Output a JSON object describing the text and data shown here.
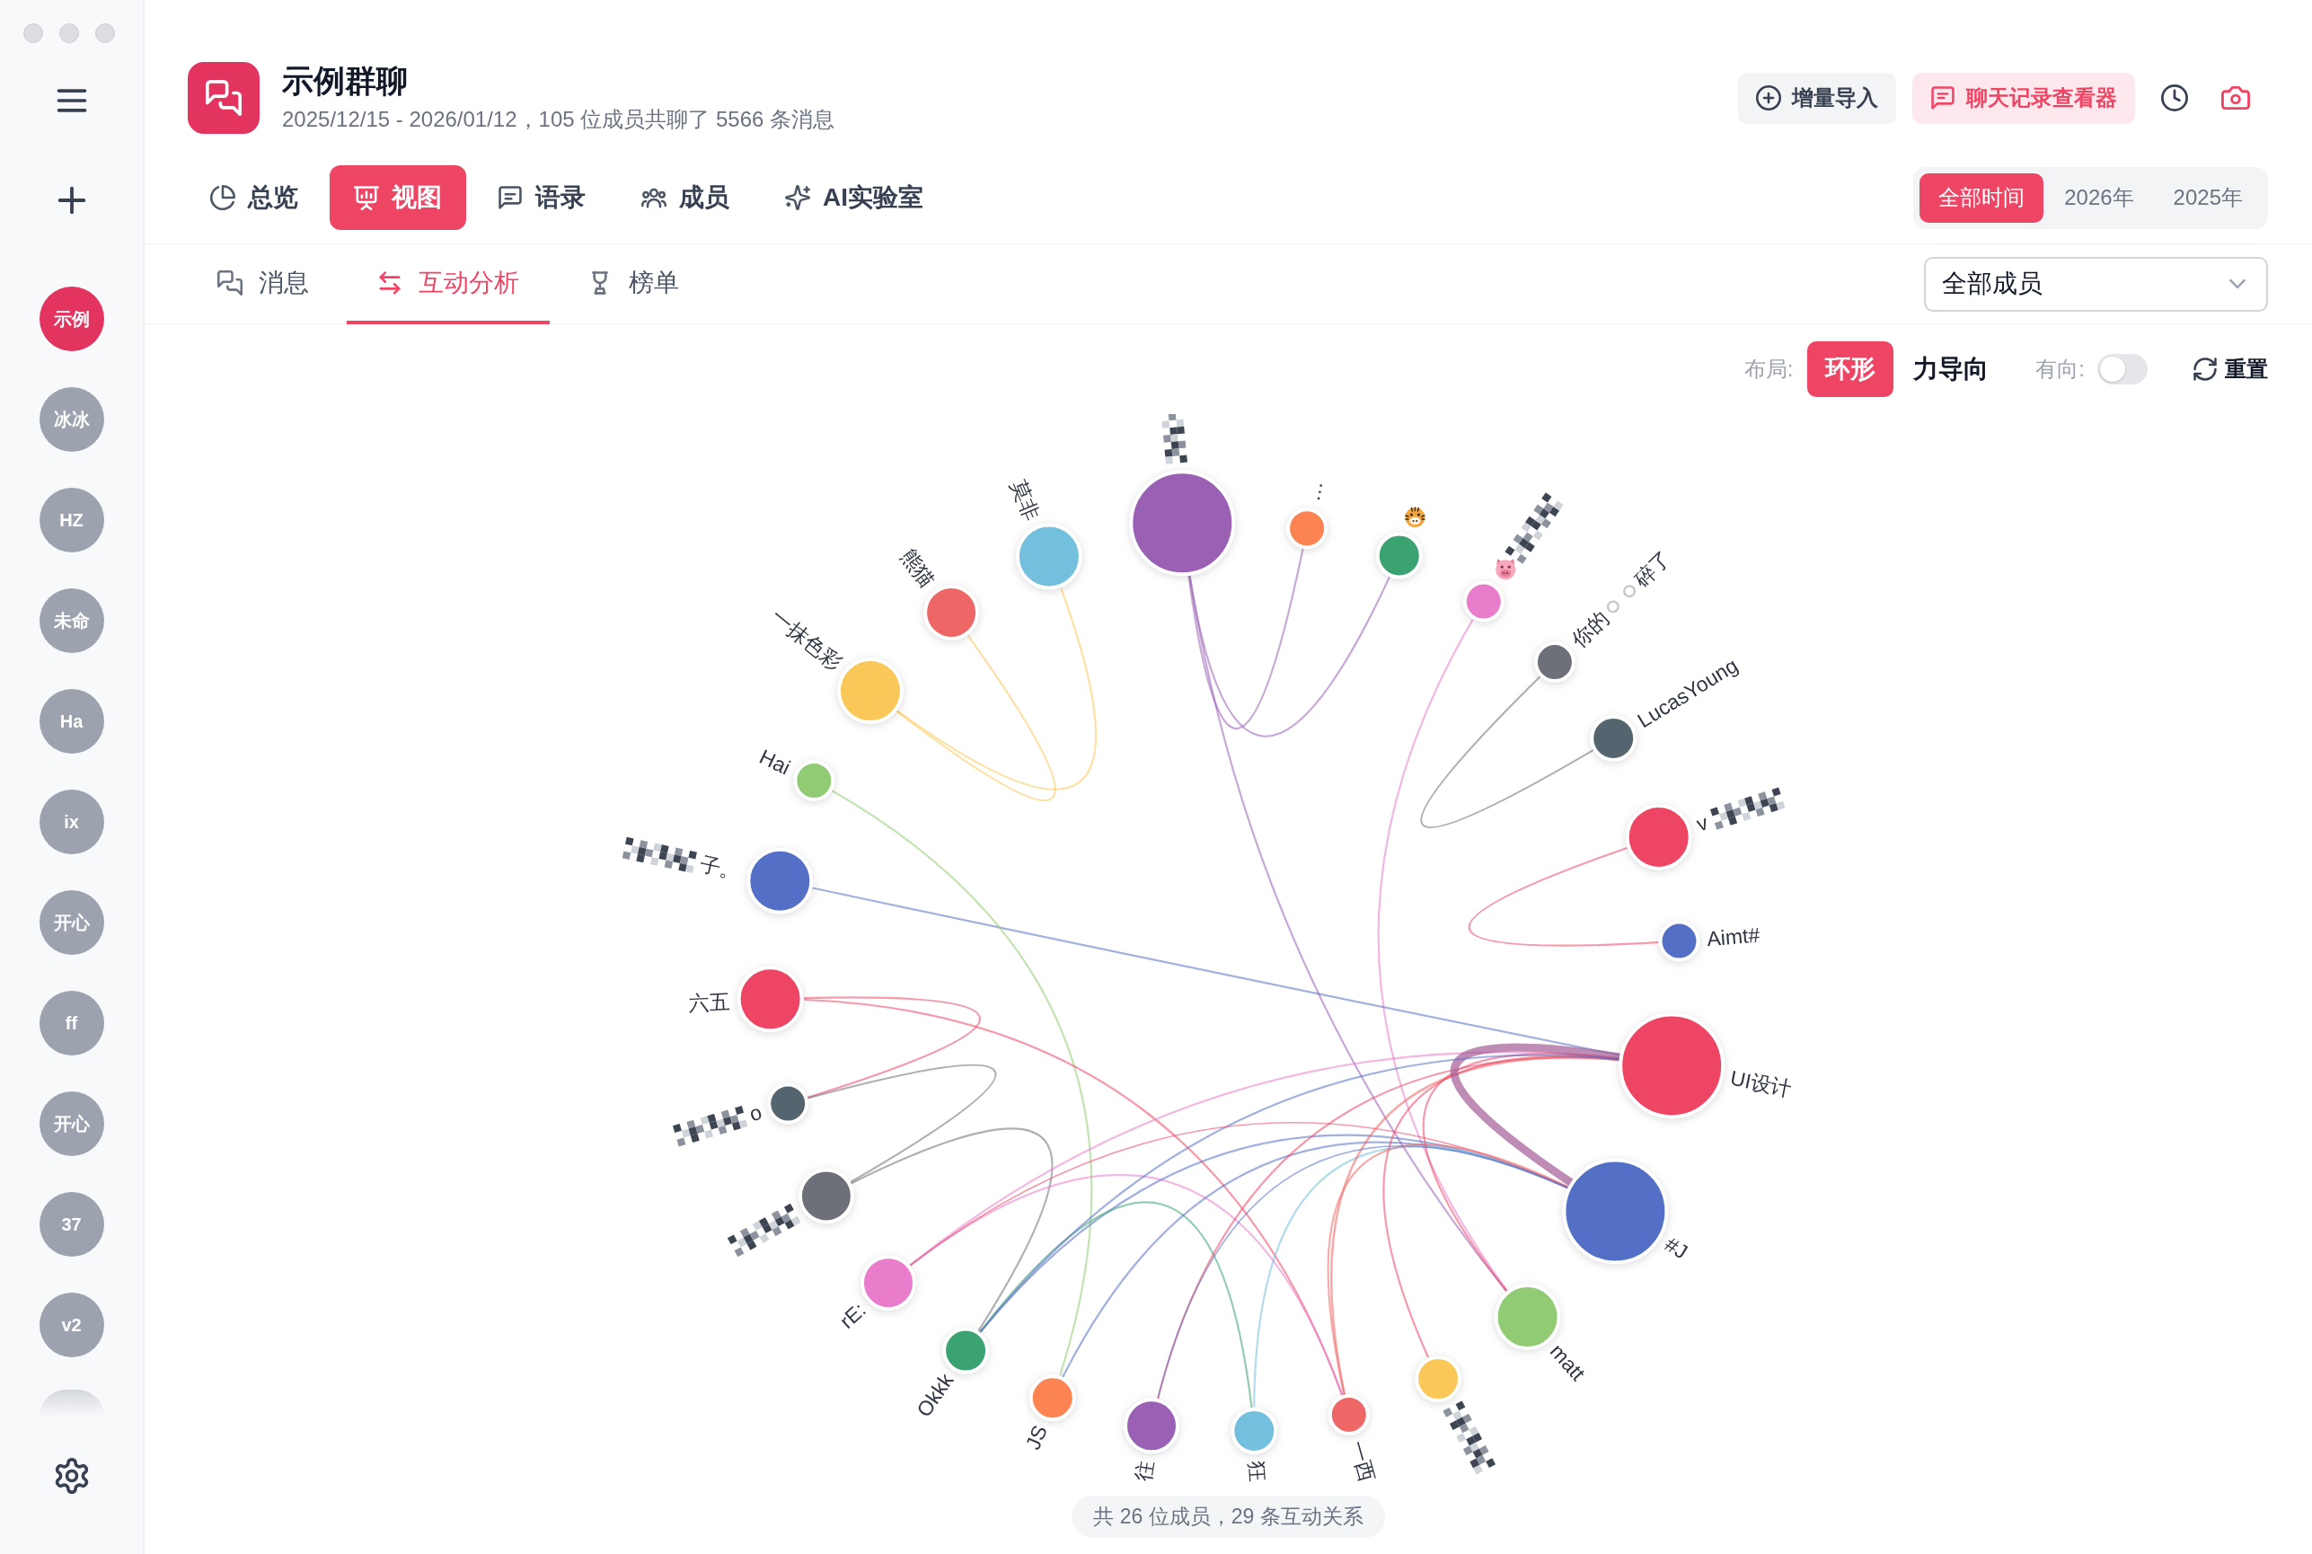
{
  "sidebar": {
    "groups": [
      {
        "label": "示例",
        "selected": true
      },
      {
        "label": "冰冰",
        "selected": false
      },
      {
        "label": "HZ",
        "selected": false
      },
      {
        "label": "未命",
        "selected": false
      },
      {
        "label": "Ha",
        "selected": false
      },
      {
        "label": "ix",
        "selected": false
      },
      {
        "label": "开心",
        "selected": false
      },
      {
        "label": "ff",
        "selected": false
      },
      {
        "label": "开心",
        "selected": false
      },
      {
        "label": "37",
        "selected": false
      },
      {
        "label": "v2",
        "selected": false
      }
    ]
  },
  "header": {
    "title": "示例群聊",
    "subtitle": "2025/12/15 - 2026/01/12，105 位成员共聊了 5566 条消息",
    "actions": [
      {
        "label": "增量导入",
        "kind": "neutral"
      },
      {
        "label": "聊天记录查看器",
        "kind": "accent"
      }
    ]
  },
  "tabs": [
    {
      "label": "总览",
      "selected": false
    },
    {
      "label": "视图",
      "selected": true
    },
    {
      "label": "语录",
      "selected": false
    },
    {
      "label": "成员",
      "selected": false
    },
    {
      "label": "AI实验室",
      "selected": false
    }
  ],
  "time_ranges": [
    {
      "label": "全部时间",
      "selected": true
    },
    {
      "label": "2026年",
      "selected": false
    },
    {
      "label": "2025年",
      "selected": false
    }
  ],
  "subtabs": [
    {
      "label": "消息",
      "selected": false
    },
    {
      "label": "互动分析",
      "selected": true
    },
    {
      "label": "榜单",
      "selected": false
    }
  ],
  "member_filter": {
    "value": "全部成员"
  },
  "graph_controls": {
    "layout_label": "布局:",
    "layouts": [
      {
        "label": "环形",
        "selected": true
      },
      {
        "label": "力导向",
        "selected": false
      }
    ],
    "directed_label": "有向:",
    "directed": false,
    "reset_label": "重置"
  },
  "graph": {
    "nodes": [
      {
        "kind": "huge",
        "color": "#9a60b4",
        "redacted": true,
        "emoji": false
      },
      {
        "kind": "tiny",
        "label": "…",
        "color": "#fc8452",
        "redacted": false,
        "emoji": false
      },
      {
        "kind": "small",
        "color": "#3ba272",
        "redacted": false,
        "emoji": true
      },
      {
        "kind": "tiny",
        "color": "#ea7ccc",
        "redacted": true,
        "emoji": true
      },
      {
        "kind": "tiny",
        "label": "你的⚪⚪碎了",
        "color": "#6e7079",
        "redacted": false,
        "emoji": false
      },
      {
        "kind": "small",
        "label": "LucasYoung",
        "color": "#546570",
        "redacted": false,
        "emoji": false
      },
      {
        "kind": "large",
        "label": "v",
        "color": "#ef4565",
        "redacted": true,
        "emoji": false
      },
      {
        "kind": "tiny",
        "label": "Aimt#",
        "color": "#5470c6",
        "redacted": false,
        "emoji": false
      },
      {
        "kind": "huge",
        "label": "UI设计",
        "color": "#ef4565",
        "redacted": false,
        "emoji": false
      },
      {
        "kind": "huge",
        "label": "#J",
        "color": "#5470c6",
        "redacted": false,
        "emoji": false
      },
      {
        "kind": "large",
        "label": "matt",
        "color": "#91cc75",
        "redacted": false,
        "emoji": false
      },
      {
        "kind": "small",
        "color": "#fac858",
        "redacted": true,
        "emoji": false
      },
      {
        "kind": "tiny",
        "label": "一西",
        "color": "#ee6666",
        "redacted": false,
        "emoji": false
      },
      {
        "kind": "small",
        "label": "狂",
        "color": "#73c0de",
        "redacted": false,
        "emoji": false
      },
      {
        "kind": "medium",
        "label": "往",
        "color": "#9a60b4",
        "redacted": false,
        "emoji": false
      },
      {
        "kind": "small",
        "label": "JS",
        "color": "#fc8452",
        "redacted": false,
        "emoji": false
      },
      {
        "kind": "small",
        "label": "Okkk",
        "color": "#3ba272",
        "redacted": false,
        "emoji": false
      },
      {
        "kind": "medium",
        "label": "rE:",
        "color": "#ea7ccc",
        "redacted": false,
        "emoji": false
      },
      {
        "kind": "medium",
        "color": "#6e7079",
        "redacted": true,
        "emoji": false
      },
      {
        "kind": "tiny",
        "label": "o",
        "color": "#546570",
        "redacted": true,
        "emoji": false
      },
      {
        "kind": "large",
        "label": "六五",
        "color": "#ef4565",
        "redacted": false,
        "emoji": false
      },
      {
        "kind": "large",
        "label": "子。",
        "color": "#5470c6",
        "redacted": true,
        "emoji": false
      },
      {
        "kind": "tiny",
        "label": "Hai",
        "color": "#91cc75",
        "redacted": false,
        "emoji": false
      },
      {
        "kind": "large",
        "label": "一抹色彩",
        "color": "#fac858",
        "redacted": false,
        "emoji": false
      },
      {
        "kind": "medium",
        "label": "熊猫",
        "color": "#ee6666",
        "redacted": false,
        "emoji": false
      },
      {
        "kind": "large",
        "label": "莫非",
        "color": "#73c0de",
        "redacted": false,
        "emoji": false
      }
    ],
    "summary": "共 26 位成员，29 条互动关系"
  }
}
